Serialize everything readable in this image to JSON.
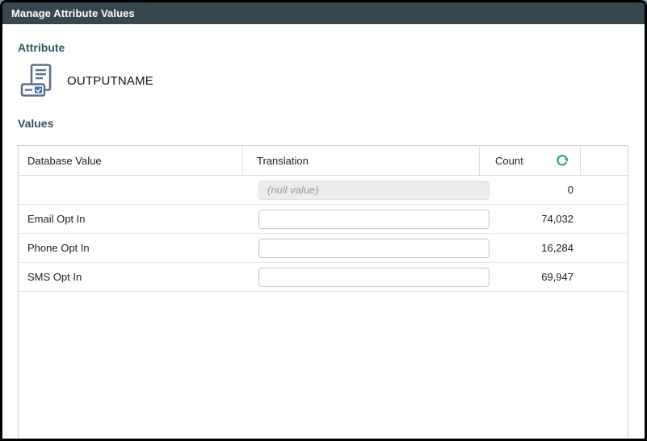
{
  "window": {
    "title": "Manage Attribute Values"
  },
  "attribute": {
    "label": "Attribute",
    "name": "OUTPUTNAME",
    "icon": "attribute-list-icon"
  },
  "values": {
    "label": "Values",
    "table": {
      "columns": [
        "Database Value",
        "Translation",
        "Count"
      ],
      "refresh_icon": "refresh-icon",
      "rows": [
        {
          "database_value": "",
          "translation_value": "",
          "translation_placeholder": "(null value)",
          "disabled": true,
          "count": "0"
        },
        {
          "database_value": "Email Opt In",
          "translation_value": "",
          "translation_placeholder": "",
          "disabled": false,
          "count": "74,032"
        },
        {
          "database_value": "Phone Opt In",
          "translation_value": "",
          "translation_placeholder": "",
          "disabled": false,
          "count": "16,284"
        },
        {
          "database_value": "SMS Opt In",
          "translation_value": "",
          "translation_placeholder": "",
          "disabled": false,
          "count": "69,947"
        }
      ]
    }
  },
  "colors": {
    "titlebar_bg": "#36474f",
    "section_label": "#33515e",
    "refresh_green": "#27a85d",
    "icon_gray_blue": "#5d7086",
    "icon_check_blue": "#3a6db4"
  }
}
